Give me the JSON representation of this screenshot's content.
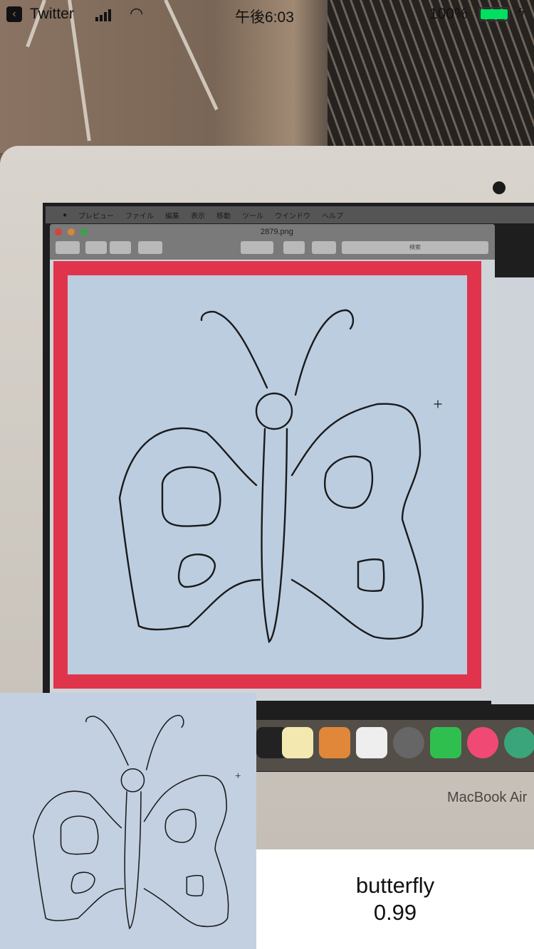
{
  "status_bar": {
    "back_app": "Twitter",
    "time": "午後6:03",
    "battery": "100%",
    "battery_color": "#00e060"
  },
  "mac": {
    "menu": [
      "プレビュー",
      "ファイル",
      "編集",
      "表示",
      "移動",
      "ツール",
      "ウインドウ",
      "ヘルプ"
    ],
    "file_name": "2879.png",
    "search_placeholder": "検索",
    "brand": "MacBook Air"
  },
  "result": {
    "label": "butterfly",
    "confidence": "0.99",
    "box_color": "#e0344c"
  }
}
